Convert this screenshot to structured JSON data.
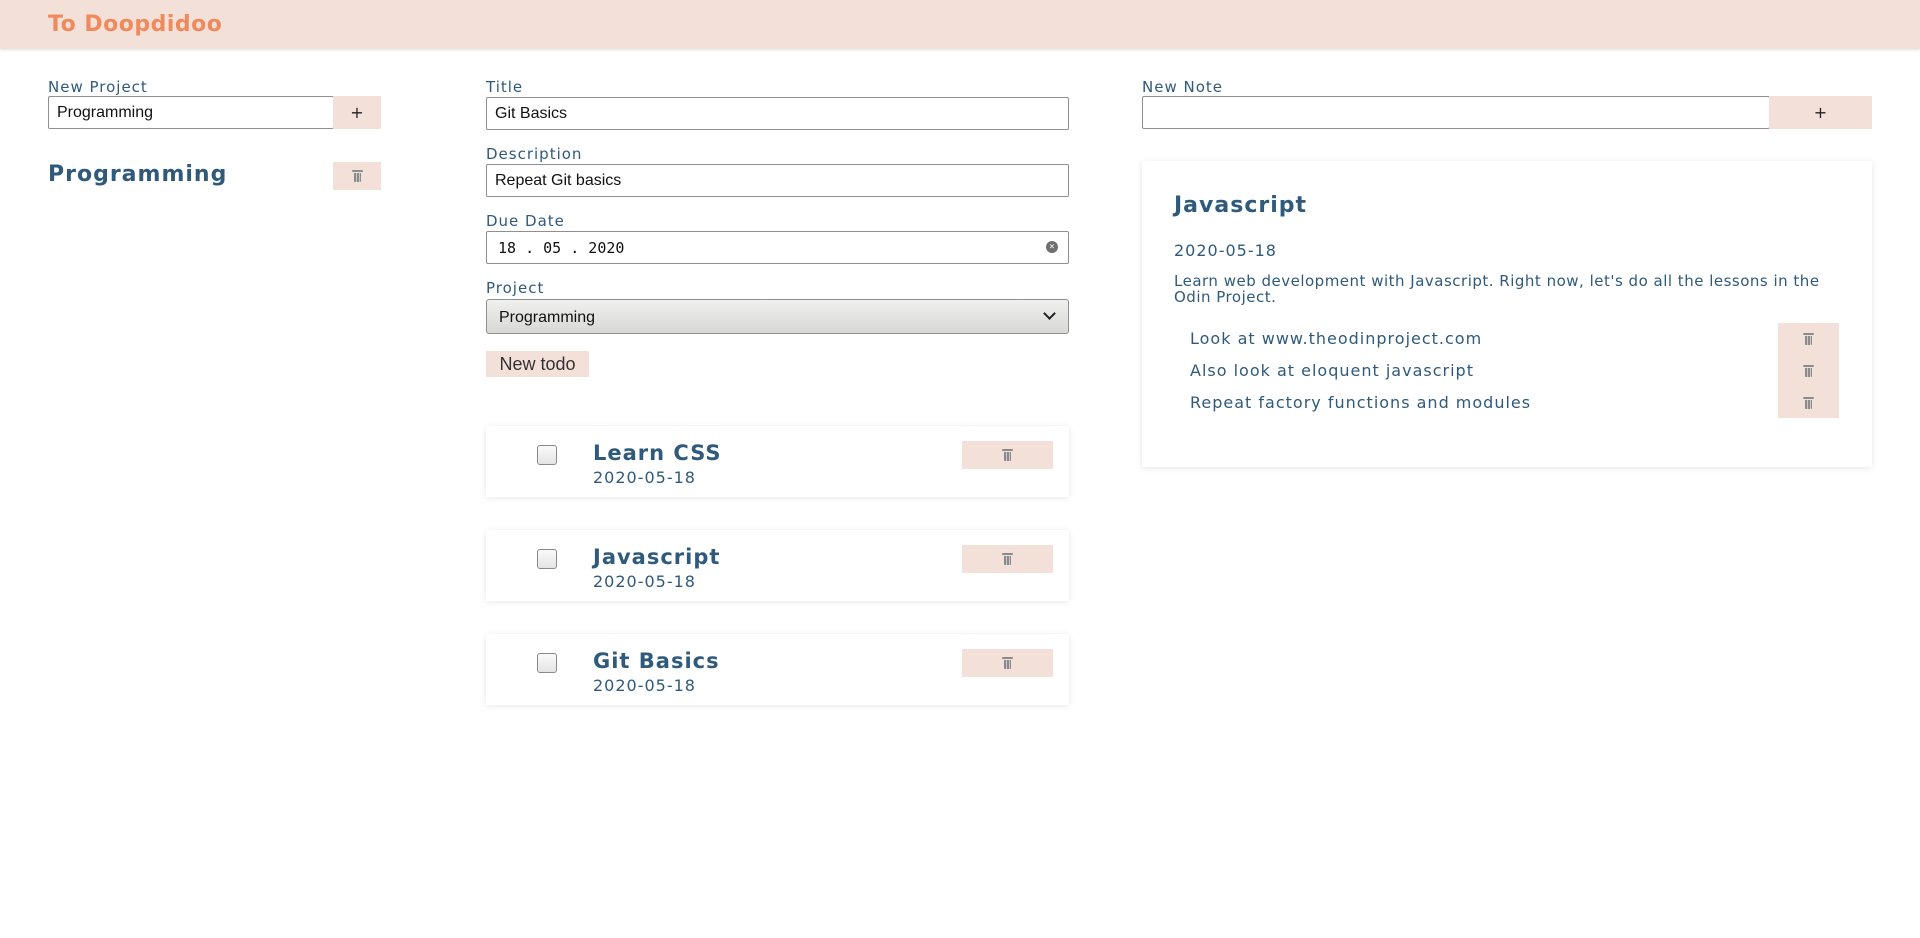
{
  "header": {
    "title": "To Doopdidoo"
  },
  "projects": {
    "new_project_label": "New Project",
    "new_project_value": "Programming",
    "add_button": "+",
    "list": [
      {
        "name": "Programming"
      }
    ]
  },
  "form": {
    "title_label": "Title",
    "title_value": "Git Basics",
    "description_label": "Description",
    "description_value": "Repeat Git basics",
    "due_date_label": "Due Date",
    "due_date_value": "18 . 05 . 2020",
    "project_label": "Project",
    "project_selected": "Programming",
    "submit_label": "New todo"
  },
  "todos": [
    {
      "title": "Learn CSS",
      "date": "2020-05-18",
      "checked": false
    },
    {
      "title": "Javascript",
      "date": "2020-05-18",
      "checked": false
    },
    {
      "title": "Git Basics",
      "date": "2020-05-18",
      "checked": false
    }
  ],
  "notes": {
    "new_note_label": "New Note",
    "new_note_value": "",
    "add_button": "+"
  },
  "detail": {
    "title": "Javascript",
    "date": "2020-05-18",
    "description": "Learn web development with Javascript. Right now, let's do all the lessons in the Odin Project.",
    "notes": [
      {
        "text": "Look at www.theodinproject.com"
      },
      {
        "text": "Also look at eloquent javascript"
      },
      {
        "text": "Repeat factory functions and modules"
      }
    ]
  },
  "colors": {
    "header_bg": "#f3e0d8",
    "accent": "#ef8a5c",
    "text": "#2f5a7c"
  },
  "icons": {
    "delete": "trash-icon",
    "clear": "clear-icon",
    "dropdown": "chevron-down-icon"
  }
}
